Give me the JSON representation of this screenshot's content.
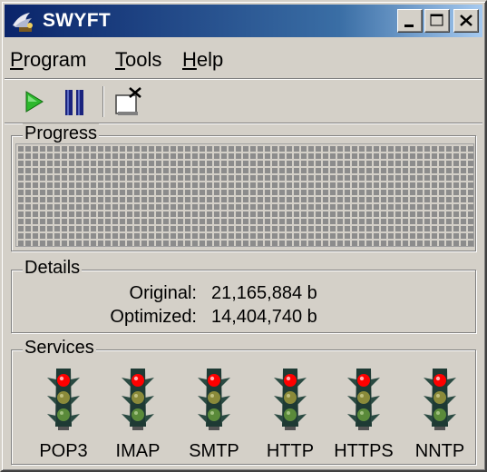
{
  "window": {
    "title": "SWYFT",
    "icon": "app-icon",
    "controls": [
      "minimize-icon",
      "maximize-icon",
      "close-icon"
    ]
  },
  "menu": {
    "items": [
      {
        "label_u": "P",
        "label_rest": "rogram"
      },
      {
        "label_u": "T",
        "label_rest": "ools"
      },
      {
        "label_u": "H",
        "label_rest": "elp"
      }
    ]
  },
  "toolbar": {
    "buttons": [
      "play-icon",
      "pause-icon",
      "disconnect-icon"
    ]
  },
  "progress": {
    "label": "Progress",
    "value": 0
  },
  "details": {
    "label": "Details",
    "original_label": "Original:",
    "original_value": "21,165,884 b",
    "optimized_label": "Optimized:",
    "optimized_value": "14,404,740 b"
  },
  "services": {
    "label": "Services",
    "items": [
      {
        "name": "POP3",
        "status": "red"
      },
      {
        "name": "IMAP",
        "status": "red"
      },
      {
        "name": "SMTP",
        "status": "red"
      },
      {
        "name": "HTTP",
        "status": "red"
      },
      {
        "name": "HTTPS",
        "status": "red"
      },
      {
        "name": "NNTP",
        "status": "red"
      }
    ]
  },
  "colors": {
    "title_active": "#0a246a",
    "face": "#d4d0c8",
    "light_red": "#ff0000",
    "play_green": "#2db82d",
    "pause_navy": "#1a237e"
  }
}
